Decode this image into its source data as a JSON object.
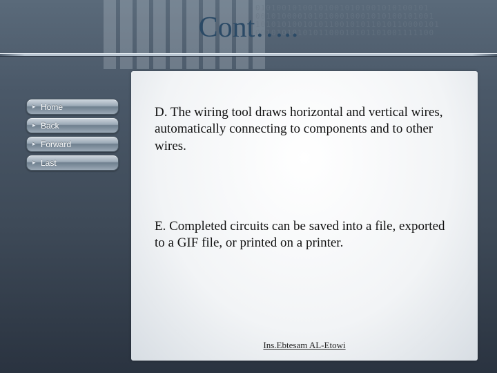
{
  "header": {
    "title": "Cont….."
  },
  "binary_decoration": "010100101001010010101001010100101\n0010100001010100010001010100101001\n10101010010101100101011010110000101\n0010101010101100010101101001111100",
  "nav": {
    "items": [
      {
        "label": "Home"
      },
      {
        "label": "Back"
      },
      {
        "label": "Forward"
      },
      {
        "label": "Last"
      }
    ]
  },
  "content": {
    "paragraphs": [
      "D. The wiring tool draws horizontal and vertical wires, automatically connecting to components and to other wires.",
      "E. Completed circuits can be saved into a file, exported to a GIF file, or printed on a printer."
    ]
  },
  "footer": {
    "author": "Ins.Ebtesam AL-Etowi"
  }
}
